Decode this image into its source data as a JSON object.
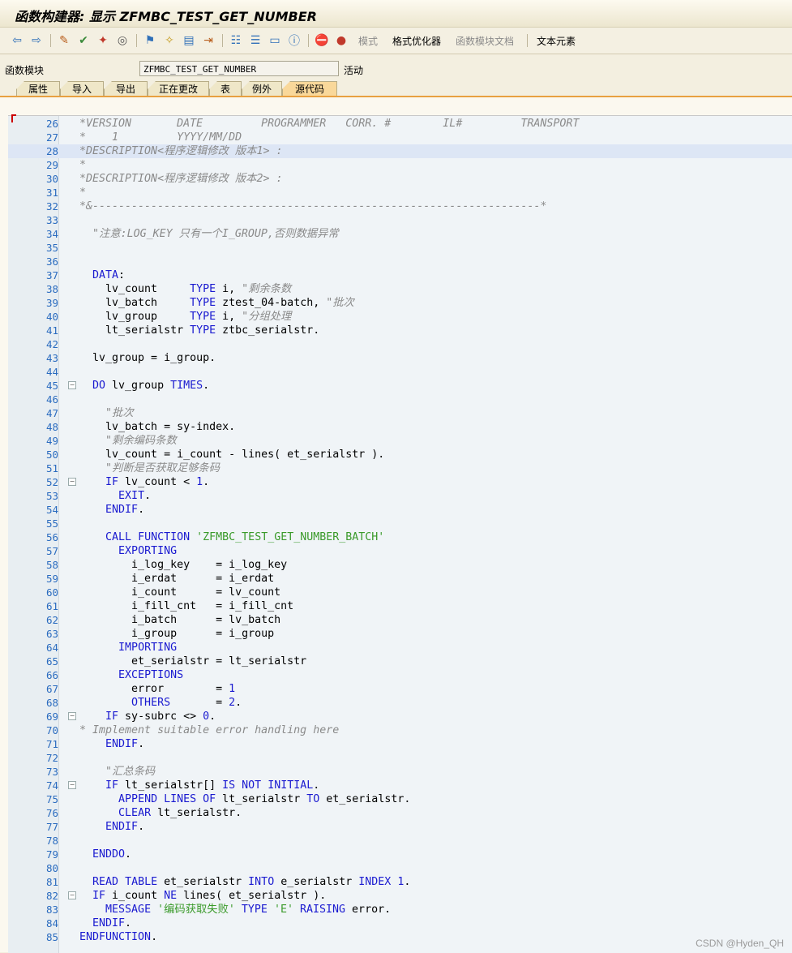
{
  "window": {
    "title": "函数构建器: 显示 ZFMBC_TEST_GET_NUMBER"
  },
  "toolbar": {
    "pattern_label": "模式",
    "pretty_printer_label": "格式优化器",
    "fm_doc_label": "函数模块文档",
    "text_elements_label": "文本元素"
  },
  "header": {
    "fm_label": "函数模块",
    "fm_value": "ZFMBC_TEST_GET_NUMBER",
    "status": "活动"
  },
  "tabs": [
    "属性",
    "导入",
    "导出",
    "正在更改",
    "表",
    "例外",
    "源代码"
  ],
  "editor": {
    "lines": [
      {
        "n": "26",
        "t": "*VERSION       DATE         PROGRAMMER   CORR. #        IL#         TRANSPORT"
      },
      {
        "n": "27",
        "t": "*    1         YYYY/MM/DD"
      },
      {
        "n": "28",
        "t": "*DESCRIPTION<程序逻辑修改 版本1> :"
      },
      {
        "n": "29",
        "t": "*"
      },
      {
        "n": "30",
        "t": "*DESCRIPTION<程序逻辑修改 版本2> :"
      },
      {
        "n": "31",
        "t": "*"
      },
      {
        "n": "32",
        "t": "*&---------------------------------------------------------------------*"
      },
      {
        "n": "33",
        "t": ""
      },
      {
        "n": "34",
        "t": "  \"注意:LOG_KEY 只有一个I_GROUP,否则数据异常"
      },
      {
        "n": "35",
        "t": ""
      },
      {
        "n": "36",
        "t": ""
      },
      {
        "n": "37",
        "t": "  DATA:"
      },
      {
        "n": "38",
        "t": "    lv_count     TYPE i, \"剩余条数"
      },
      {
        "n": "39",
        "t": "    lv_batch     TYPE ztest_04-batch, \"批次"
      },
      {
        "n": "40",
        "t": "    lv_group     TYPE i, \"分组处理"
      },
      {
        "n": "41",
        "t": "    lt_serialstr TYPE ztbc_serialstr."
      },
      {
        "n": "42",
        "t": ""
      },
      {
        "n": "43",
        "t": "  lv_group = i_group."
      },
      {
        "n": "44",
        "t": ""
      },
      {
        "n": "45",
        "t": "  DO lv_group TIMES."
      },
      {
        "n": "46",
        "t": ""
      },
      {
        "n": "47",
        "t": "    \"批次"
      },
      {
        "n": "48",
        "t": "    lv_batch = sy-index."
      },
      {
        "n": "49",
        "t": "    \"剩余编码条数"
      },
      {
        "n": "50",
        "t": "    lv_count = i_count - lines( et_serialstr )."
      },
      {
        "n": "51",
        "t": "    \"判断是否获取足够条码"
      },
      {
        "n": "52",
        "t": "    IF lv_count < 1."
      },
      {
        "n": "53",
        "t": "      EXIT."
      },
      {
        "n": "54",
        "t": "    ENDIF."
      },
      {
        "n": "55",
        "t": ""
      },
      {
        "n": "56",
        "t": "    CALL FUNCTION 'ZFMBC_TEST_GET_NUMBER_BATCH'"
      },
      {
        "n": "57",
        "t": "      EXPORTING"
      },
      {
        "n": "58",
        "t": "        i_log_key    = i_log_key"
      },
      {
        "n": "59",
        "t": "        i_erdat      = i_erdat"
      },
      {
        "n": "60",
        "t": "        i_count      = lv_count"
      },
      {
        "n": "61",
        "t": "        i_fill_cnt   = i_fill_cnt"
      },
      {
        "n": "62",
        "t": "        i_batch      = lv_batch"
      },
      {
        "n": "63",
        "t": "        i_group      = i_group"
      },
      {
        "n": "64",
        "t": "      IMPORTING"
      },
      {
        "n": "65",
        "t": "        et_serialstr = lt_serialstr"
      },
      {
        "n": "66",
        "t": "      EXCEPTIONS"
      },
      {
        "n": "67",
        "t": "        error        = 1"
      },
      {
        "n": "68",
        "t": "        OTHERS       = 2."
      },
      {
        "n": "69",
        "t": "    IF sy-subrc <> 0."
      },
      {
        "n": "70",
        "t": "* Implement suitable error handling here"
      },
      {
        "n": "71",
        "t": "    ENDIF."
      },
      {
        "n": "72",
        "t": ""
      },
      {
        "n": "73",
        "t": "    \"汇总条码"
      },
      {
        "n": "74",
        "t": "    IF lt_serialstr[] IS NOT INITIAL."
      },
      {
        "n": "75",
        "t": "      APPEND LINES OF lt_serialstr TO et_serialstr."
      },
      {
        "n": "76",
        "t": "      CLEAR lt_serialstr."
      },
      {
        "n": "77",
        "t": "    ENDIF."
      },
      {
        "n": "78",
        "t": ""
      },
      {
        "n": "79",
        "t": "  ENDDO."
      },
      {
        "n": "80",
        "t": ""
      },
      {
        "n": "81",
        "t": "  READ TABLE et_serialstr INTO e_serialstr INDEX 1."
      },
      {
        "n": "82",
        "t": "  IF i_count NE lines( et_serialstr )."
      },
      {
        "n": "83",
        "t": "    MESSAGE '编码获取失败' TYPE 'E' RAISING error."
      },
      {
        "n": "84",
        "t": "  ENDIF."
      },
      {
        "n": "85",
        "t": "ENDFUNCTION."
      }
    ]
  },
  "watermark": "CSDN @Hyden_QH"
}
